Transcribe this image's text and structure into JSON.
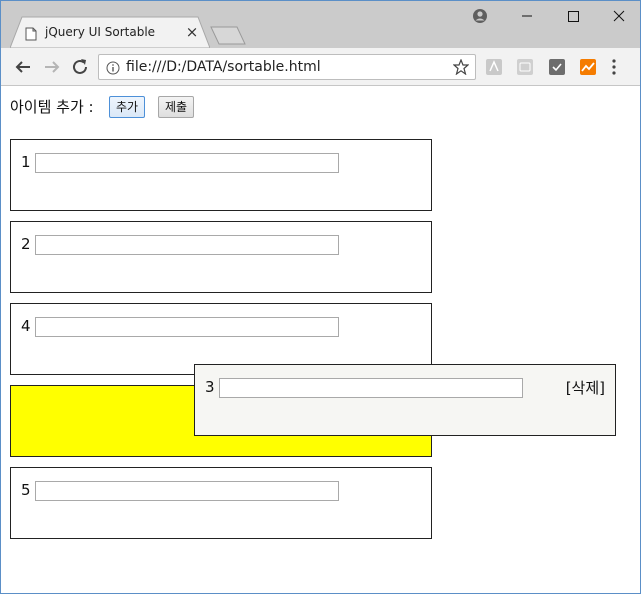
{
  "tab": {
    "title": "jQuery UI Sortable",
    "close_icon": "×"
  },
  "address_bar": {
    "url": "file:///D:/DATA/sortable.html"
  },
  "page": {
    "add_label": "아이템 추가 :",
    "add_button": "추가",
    "submit_button": "제출",
    "items": [
      {
        "number": "1",
        "value": ""
      },
      {
        "number": "2",
        "value": ""
      },
      {
        "number": "4",
        "value": ""
      },
      {
        "number": "5",
        "value": ""
      }
    ],
    "dragging_item": {
      "number": "3",
      "value": "",
      "delete_label": "[삭제]"
    },
    "placeholder_color": "#ffff00"
  }
}
